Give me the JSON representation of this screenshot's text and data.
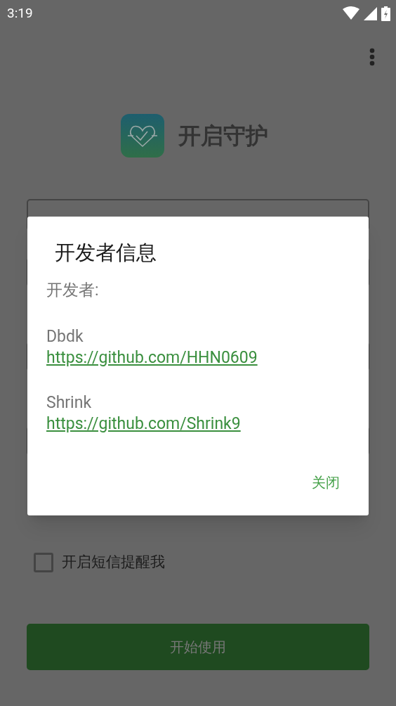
{
  "status_bar": {
    "time": "3:19"
  },
  "header": {
    "title": "开启守护"
  },
  "sms_option": {
    "label": "开启短信提醒我",
    "checked": false
  },
  "start_button": {
    "label": "开始使用",
    "disabled": true
  },
  "dialog": {
    "title": "开发者信息",
    "intro": "开发者:",
    "developers": [
      {
        "name": "Dbdk",
        "link": "https://github.com/HHN0609"
      },
      {
        "name": "Shrink",
        "link": "https://github.com/Shrink9"
      }
    ],
    "close_button": "关闭"
  }
}
